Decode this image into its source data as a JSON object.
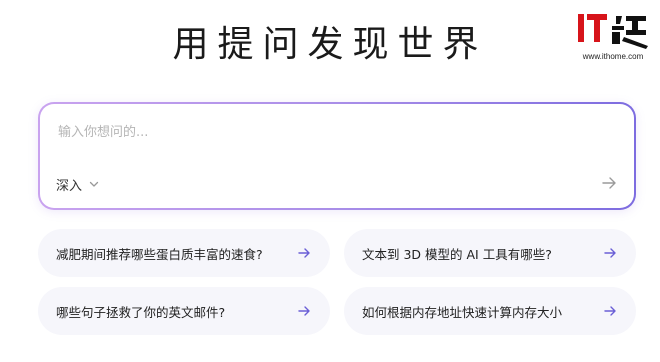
{
  "hero": {
    "title": "用提问发现世界"
  },
  "watermark": {
    "logo_text": "IT之家",
    "url": "www.ithome.com"
  },
  "search": {
    "placeholder": "输入你想问的...",
    "value": "",
    "mode_label": "深入"
  },
  "suggestions": [
    {
      "label": "减肥期间推荐哪些蛋白质丰富的速食?"
    },
    {
      "label": "文本到 3D 模型的 AI 工具有哪些?"
    },
    {
      "label": "哪些句子拯救了你的英文邮件?"
    },
    {
      "label": "如何根据内存地址快速计算内存大小"
    }
  ],
  "colors": {
    "accent_start": "#c9a3ef",
    "accent_end": "#7d6ce0",
    "arrow": "#6a5fd6",
    "card_bg": "#f6f6fb"
  },
  "icons": {
    "chevron": "chevron-down-icon",
    "submit": "arrow-right-icon",
    "suggestion_arrow": "arrow-right-icon"
  }
}
